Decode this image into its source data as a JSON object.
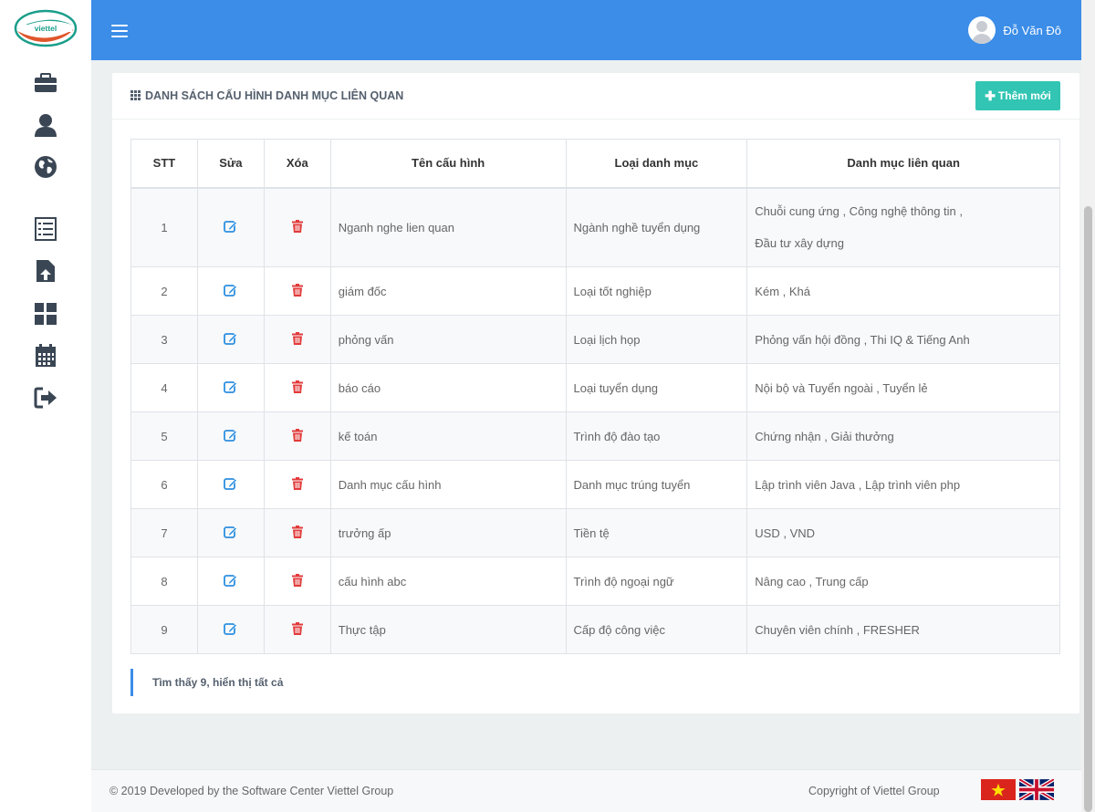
{
  "brand": {
    "logo_text": "viettel"
  },
  "sidebar": {
    "icons": [
      "briefcase-icon",
      "user-icon",
      "globe-icon",
      "list-icon",
      "file-upload-icon",
      "dashboard-icon",
      "calendar-icon",
      "logout-icon"
    ]
  },
  "header": {
    "user_name": "Đỗ Văn Đô"
  },
  "card": {
    "title": "DANH SÁCH CẤU HÌNH DANH MỤC LIÊN QUAN",
    "add_button": "Thêm mới"
  },
  "table": {
    "columns": [
      "STT",
      "Sửa",
      "Xóa",
      "Tên cấu hình",
      "Loại danh mục",
      "Danh mục liên quan"
    ],
    "rows": [
      {
        "stt": "1",
        "name": "Nganh nghe lien quan",
        "type": "Ngành nghề tuyển dụng",
        "related": "Chuỗi cung ứng , Công nghệ thông tin ,",
        "related2": "Đầu tư xây dựng"
      },
      {
        "stt": "2",
        "name": "giám đốc",
        "type": "Loại tốt nghiệp",
        "related": "Kém , Khá"
      },
      {
        "stt": "3",
        "name": "phỏng vấn",
        "type": "Loại lịch họp",
        "related": "Phỏng vấn hội đồng , Thi IQ & Tiếng Anh"
      },
      {
        "stt": "4",
        "name": "báo cáo",
        "type": "Loại tuyển dụng",
        "related": "Nội bộ và Tuyển ngoài , Tuyển lẻ"
      },
      {
        "stt": "5",
        "name": "kế toán",
        "type": "Trình độ đào tạo",
        "related": "Chứng nhận , Giải thưởng"
      },
      {
        "stt": "6",
        "name": "Danh mục cấu hình",
        "type": "Danh mục trúng tuyển",
        "related": "Lập trình viên Java , Lập trình viên php"
      },
      {
        "stt": "7",
        "name": "trưởng ấp",
        "type": "Tiền tệ",
        "related": "USD , VND"
      },
      {
        "stt": "8",
        "name": "cấu hình abc",
        "type": "Trình độ ngoại ngữ",
        "related": "Nâng cao , Trung cấp"
      },
      {
        "stt": "9",
        "name": "Thực tập",
        "type": "Cấp độ công việc",
        "related": "Chuyên viên chính , FRESHER"
      }
    ],
    "summary": "Tìm thấy 9, hiển thị tất cả"
  },
  "footer": {
    "left": "© 2019 Developed by the Software Center Viettel Group",
    "right": "Copyright of Viettel Group"
  },
  "colors": {
    "primary": "#3b8de8",
    "accent": "#32c5b4",
    "edit": "#2c8fe0",
    "delete": "#e23b3b"
  }
}
